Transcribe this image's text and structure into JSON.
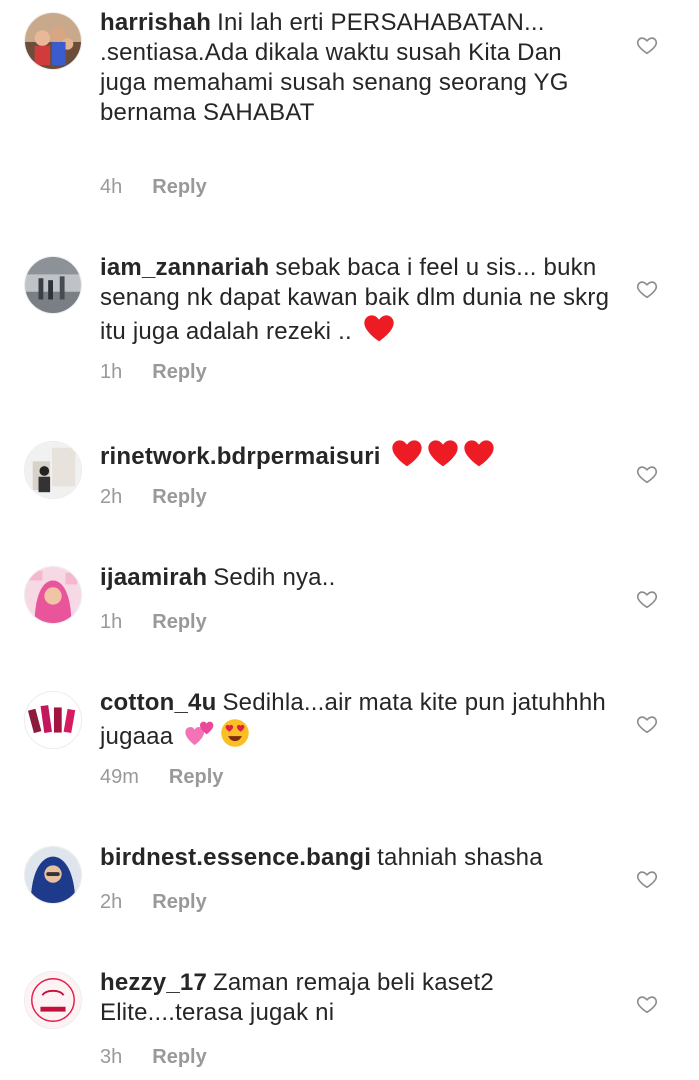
{
  "reply_label": "Reply",
  "comments": [
    {
      "username": "harrishah",
      "text": "Ini lah erti PERSAHABATAN... .sentiasa.Ada dikala waktu susah Kita Dan juga memahami susah senang seorang YG bernama SAHABAT",
      "time": "4h",
      "emojis": [],
      "avatar": "family-photo"
    },
    {
      "username": "iam_zannariah",
      "text": "sebak baca i feel u sis... bukn senang nk dapat kawan baik dlm dunia ne skrg itu juga adalah rezeki ..",
      "time": "1h",
      "emojis": [
        "red-heart"
      ],
      "avatar": "mall-photo"
    },
    {
      "username": "rinetwork.bdrpermaisuri",
      "text": "",
      "time": "2h",
      "emojis": [
        "red-heart",
        "red-heart",
        "red-heart"
      ],
      "avatar": "store-photo"
    },
    {
      "username": "ijaamirah",
      "text": "Sedih nya..",
      "time": "1h",
      "emojis": [],
      "avatar": "pink-hijab-photo"
    },
    {
      "username": "cotton_4u",
      "text": "Sedihla...air mata kite pun jatuhhhh jugaaa",
      "time": "49m",
      "emojis": [
        "two-hearts",
        "heart-eyes"
      ],
      "avatar": "lipsticks-photo"
    },
    {
      "username": "birdnest.essence.bangi",
      "text": "tahniah shasha",
      "time": "2h",
      "emojis": [],
      "avatar": "blue-hijab-photo"
    },
    {
      "username": "hezzy_17",
      "text": "Zaman remaja beli kaset2 Elite....terasa jugak ni",
      "time": "3h",
      "emojis": [],
      "avatar": "avon-logo"
    }
  ],
  "colors": {
    "username": "#262626",
    "meta": "#999999",
    "heart": "#ed1c24",
    "pink_heart": "#f472b6"
  },
  "icons": {
    "like": "heart-outline-icon"
  }
}
